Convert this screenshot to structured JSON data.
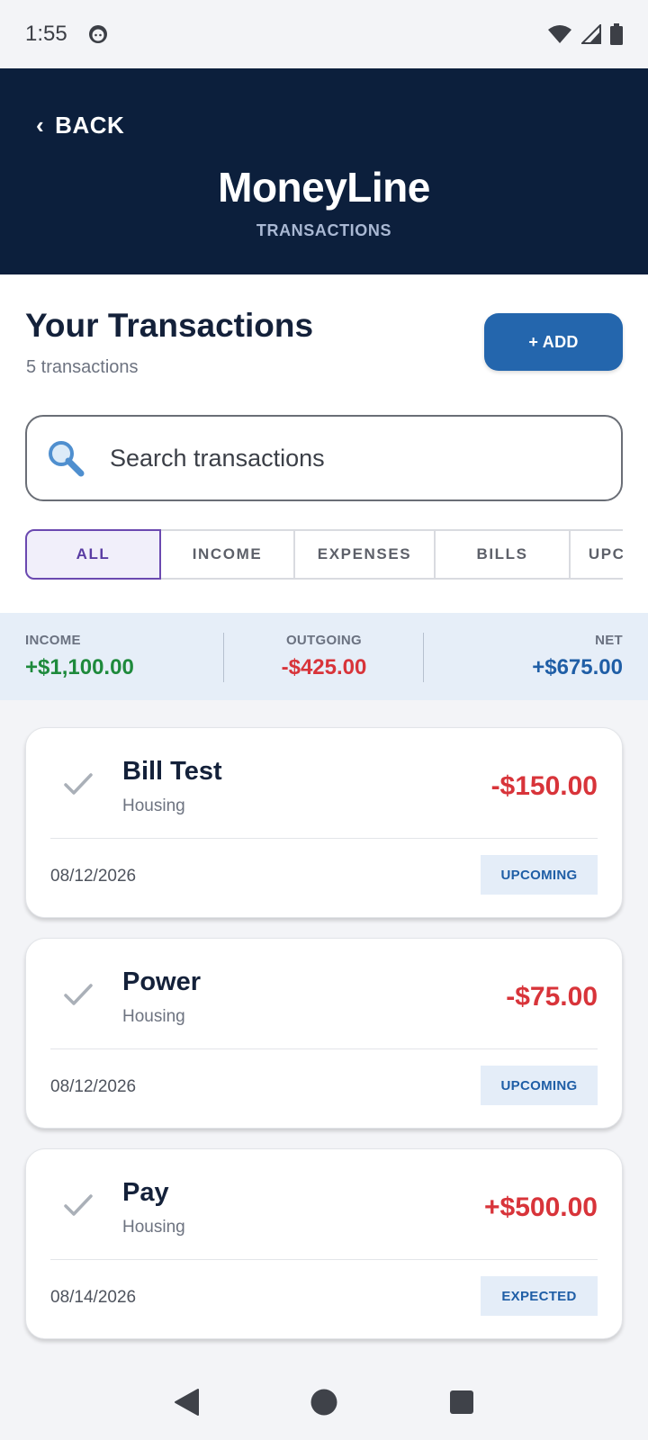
{
  "status_bar": {
    "time": "1:55"
  },
  "header": {
    "back_label": "BACK",
    "app_title": "MoneyLine",
    "subtitle": "TRANSACTIONS"
  },
  "page": {
    "title": "Your Transactions",
    "count": "5 transactions",
    "add_label": "+ ADD"
  },
  "search": {
    "placeholder": "Search transactions",
    "value": ""
  },
  "filters": [
    "ALL",
    "INCOME",
    "EXPENSES",
    "BILLS",
    "UPCOMING"
  ],
  "summary": {
    "income_label": "INCOME",
    "income_value": "+$1,100.00",
    "outgoing_label": "OUTGOING",
    "outgoing_value": "-$425.00",
    "net_label": "NET",
    "net_value": "+$675.00"
  },
  "transactions": [
    {
      "name": "Bill Test",
      "category": "Housing",
      "amount": "-$150.00",
      "date": "08/12/2026",
      "status": "UPCOMING"
    },
    {
      "name": "Power",
      "category": "Housing",
      "amount": "-$75.00",
      "date": "08/12/2026",
      "status": "UPCOMING"
    },
    {
      "name": "Pay",
      "category": "Housing",
      "amount": "+$500.00",
      "date": "08/14/2026",
      "status": "EXPECTED"
    }
  ],
  "colors": {
    "header_bg": "#0c1f3c",
    "accent_blue": "#2466ad",
    "income_green": "#1e8a3c",
    "expense_red": "#d8343a",
    "net_blue": "#1f5ea6",
    "active_filter": "#6b49b0"
  },
  "icons": {
    "status_left": "face-icon",
    "status_right": [
      "wifi-icon",
      "signal-icon",
      "battery-icon"
    ],
    "search": "search-icon",
    "check": "check-icon",
    "nav": [
      "back-triangle-icon",
      "home-circle-icon",
      "recents-square-icon"
    ]
  }
}
